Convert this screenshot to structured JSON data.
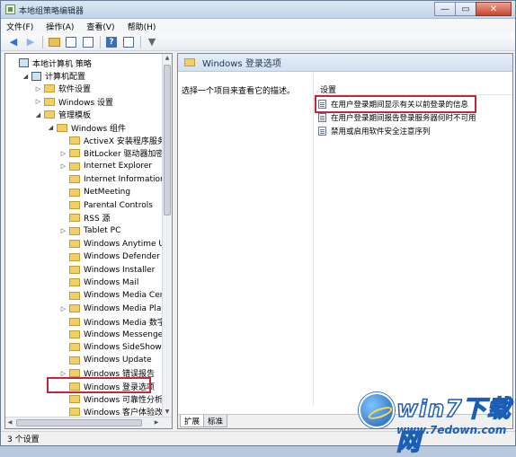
{
  "window": {
    "title": "本地组策略编辑器",
    "buttons": {
      "minimize": "—",
      "maximize": "▭",
      "close": "✕"
    }
  },
  "menu": [
    "文件(F)",
    "操作(A)",
    "查看(V)",
    "帮助(H)"
  ],
  "toolbar": {
    "back": "◀",
    "forward": "▶",
    "help": "?",
    "filter": "▼"
  },
  "tree": [
    {
      "label": "本地计算机 策略",
      "level": 0,
      "icon": "computer-icon",
      "expander": ""
    },
    {
      "label": "计算机配置",
      "level": 1,
      "icon": "computer-icon",
      "expander": "◢"
    },
    {
      "label": "软件设置",
      "level": 2,
      "icon": "folder-icon",
      "expander": "▷"
    },
    {
      "label": "Windows 设置",
      "level": 2,
      "icon": "folder-icon",
      "expander": "▷"
    },
    {
      "label": "管理模板",
      "level": 2,
      "icon": "folder-icon",
      "expander": "◢"
    },
    {
      "label": "Windows 组件",
      "level": 3,
      "icon": "folder-icon",
      "expander": "◢"
    },
    {
      "label": "ActiveX 安装程序服务",
      "level": 4,
      "icon": "folder-icon",
      "expander": ""
    },
    {
      "label": "BitLocker 驱动器加密",
      "level": 4,
      "icon": "folder-icon",
      "expander": "▷"
    },
    {
      "label": "Internet Explorer",
      "level": 4,
      "icon": "folder-icon",
      "expander": "▷"
    },
    {
      "label": "Internet Information Ser",
      "level": 4,
      "icon": "folder-icon",
      "expander": ""
    },
    {
      "label": "NetMeeting",
      "level": 4,
      "icon": "folder-icon",
      "expander": ""
    },
    {
      "label": "Parental Controls",
      "level": 4,
      "icon": "folder-icon",
      "expander": ""
    },
    {
      "label": "RSS 源",
      "level": 4,
      "icon": "folder-icon",
      "expander": ""
    },
    {
      "label": "Tablet PC",
      "level": 4,
      "icon": "folder-icon",
      "expander": "▷"
    },
    {
      "label": "Windows Anytime Upgr",
      "level": 4,
      "icon": "folder-icon",
      "expander": ""
    },
    {
      "label": "Windows Defender",
      "level": 4,
      "icon": "folder-icon",
      "expander": ""
    },
    {
      "label": "Windows Installer",
      "level": 4,
      "icon": "folder-icon",
      "expander": ""
    },
    {
      "label": "Windows Mail",
      "level": 4,
      "icon": "folder-icon",
      "expander": ""
    },
    {
      "label": "Windows Media Center",
      "level": 4,
      "icon": "folder-icon",
      "expander": ""
    },
    {
      "label": "Windows Media Player",
      "level": 4,
      "icon": "folder-icon",
      "expander": "▷"
    },
    {
      "label": "Windows Media 数字权限",
      "level": 4,
      "icon": "folder-icon",
      "expander": ""
    },
    {
      "label": "Windows Messenger",
      "level": 4,
      "icon": "folder-icon",
      "expander": ""
    },
    {
      "label": "Windows SideShow",
      "level": 4,
      "icon": "folder-icon",
      "expander": ""
    },
    {
      "label": "Windows Update",
      "level": 4,
      "icon": "folder-icon",
      "expander": ""
    },
    {
      "label": "Windows 错误报告",
      "level": 4,
      "icon": "folder-icon",
      "expander": "▷"
    },
    {
      "label": "Windows 登录选项",
      "level": 4,
      "icon": "folder-icon",
      "expander": ""
    },
    {
      "label": "Windows 可靠性分析",
      "level": 4,
      "icon": "folder-icon",
      "expander": ""
    },
    {
      "label": "Windows 客户体验改善计",
      "level": 4,
      "icon": "folder-icon",
      "expander": ""
    }
  ],
  "right": {
    "header": "Windows 登录选项",
    "description": "选择一个项目来查看它的描述。",
    "column_header": "设置",
    "settings": [
      "在用户登录期间显示有关以前登录的信息",
      "在用户登录期间报告登录服务器何时不可用",
      "禁用或启用软件安全注意序列"
    ],
    "tabs": [
      "扩展",
      "标准"
    ]
  },
  "status": "3 个设置",
  "watermark": {
    "brand": "win7下载网",
    "url": "www.7edown.com"
  }
}
